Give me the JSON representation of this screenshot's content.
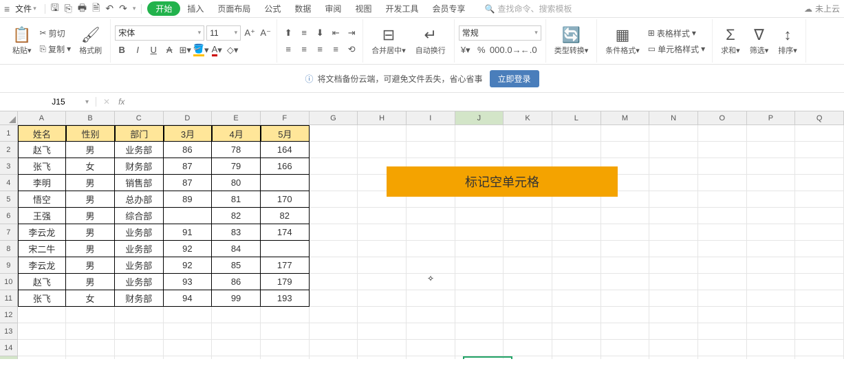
{
  "menu": {
    "file": "文件",
    "search_placeholder": "查找命令、搜索模板",
    "cloud_status": "未上云"
  },
  "tabs": [
    "开始",
    "插入",
    "页面布局",
    "公式",
    "数据",
    "审阅",
    "视图",
    "开发工具",
    "会员专享"
  ],
  "ribbon": {
    "paste": "粘贴",
    "cut": "剪切",
    "copy": "复制",
    "format_painter": "格式刷",
    "font_name": "宋体",
    "font_size": "11",
    "merge": "合并居中",
    "wrap": "自动换行",
    "numfmt": "常规",
    "type_convert": "类型转换",
    "cond_fmt": "条件格式",
    "table_style": "表格样式",
    "cell_style": "单元格样式",
    "sum": "求和",
    "filter": "筛选",
    "sort": "排序"
  },
  "banner": {
    "text": "将文档备份云端，可避免文件丢失，省心省事",
    "login": "立即登录"
  },
  "formula_bar": {
    "cell_ref": "J15"
  },
  "columns": [
    "A",
    "B",
    "C",
    "D",
    "E",
    "F",
    "G",
    "H",
    "I",
    "J",
    "K",
    "L",
    "M",
    "N",
    "O",
    "P",
    "Q"
  ],
  "table": {
    "headers": [
      "姓名",
      "性别",
      "部门",
      "3月",
      "4月",
      "5月"
    ],
    "rows": [
      [
        "赵飞",
        "男",
        "业务部",
        "86",
        "78",
        "164"
      ],
      [
        "张飞",
        "女",
        "财务部",
        "87",
        "79",
        "166"
      ],
      [
        "李明",
        "男",
        "销售部",
        "87",
        "80",
        ""
      ],
      [
        "悟空",
        "男",
        "总办部",
        "89",
        "81",
        "170"
      ],
      [
        "王强",
        "男",
        "综合部",
        "",
        "82",
        "82"
      ],
      [
        "李云龙",
        "男",
        "业务部",
        "91",
        "83",
        "174"
      ],
      [
        "宋二牛",
        "男",
        "业务部",
        "92",
        "84",
        ""
      ],
      [
        "李云龙",
        "男",
        "业务部",
        "92",
        "85",
        "177"
      ],
      [
        "赵飞",
        "男",
        "业务部",
        "93",
        "86",
        "179"
      ],
      [
        "张飞",
        "女",
        "财务部",
        "94",
        "99",
        "193"
      ]
    ]
  },
  "note": "标记空单元格",
  "active_cell": "J15"
}
